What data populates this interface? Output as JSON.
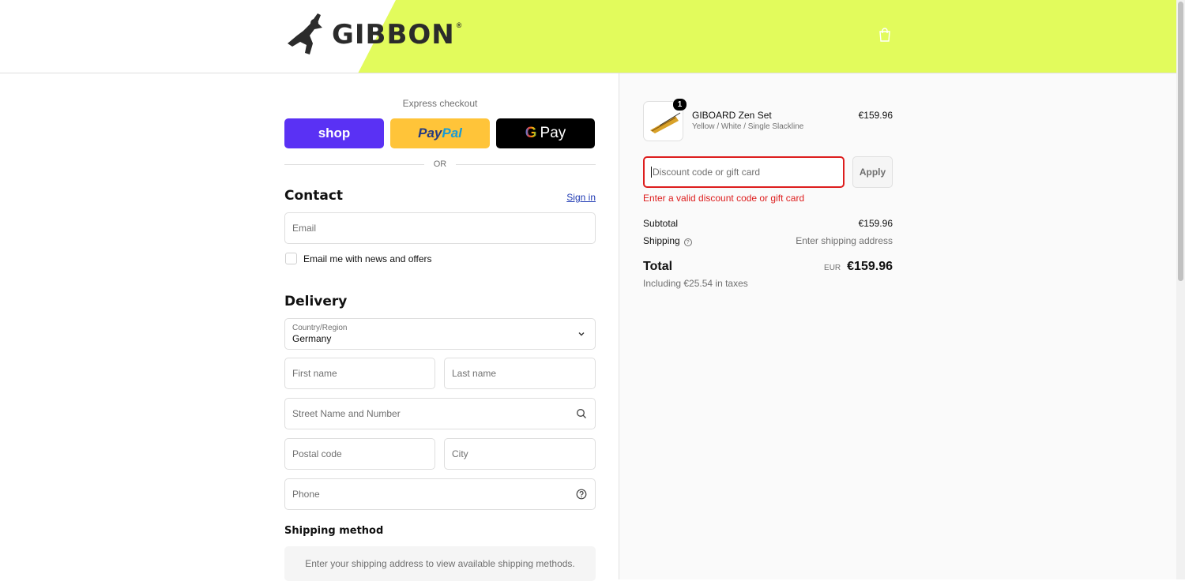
{
  "header": {
    "brand": "GIBBON",
    "brand_mark": "®",
    "accent_color": "#e2fb5c",
    "cart_icon": "shopping-bag-icon"
  },
  "express": {
    "title": "Express checkout",
    "shop_label": "shop",
    "paypal_label_a": "Pay",
    "paypal_label_b": "Pal",
    "gpay_g": "G",
    "gpay_label": "Pay",
    "or_label": "OR"
  },
  "contact": {
    "title": "Contact",
    "sign_in": "Sign in",
    "email_placeholder": "Email",
    "newsletter_label": "Email me with news and offers"
  },
  "delivery": {
    "title": "Delivery",
    "country_label": "Country/Region",
    "country_value": "Germany",
    "first_name": "First name",
    "last_name": "Last name",
    "street": "Street Name and Number",
    "postal": "Postal code",
    "city": "City",
    "phone": "Phone"
  },
  "shipping_method": {
    "title": "Shipping method",
    "message": "Enter your shipping address to view available shipping methods."
  },
  "summary": {
    "product": {
      "name": "GIBOARD Zen Set",
      "variant": "Yellow / White / Single Slackline",
      "price": "€159.96",
      "quantity": "1"
    },
    "discount_placeholder": "Discount code or gift card",
    "apply": "Apply",
    "error": "Enter a valid discount code or gift card",
    "subtotal_label": "Subtotal",
    "subtotal_value": "€159.96",
    "shipping_label": "Shipping",
    "shipping_value": "Enter shipping address",
    "total_label": "Total",
    "total_currency": "EUR",
    "total_value": "€159.96",
    "tax_note": "Including €25.54 in taxes"
  }
}
